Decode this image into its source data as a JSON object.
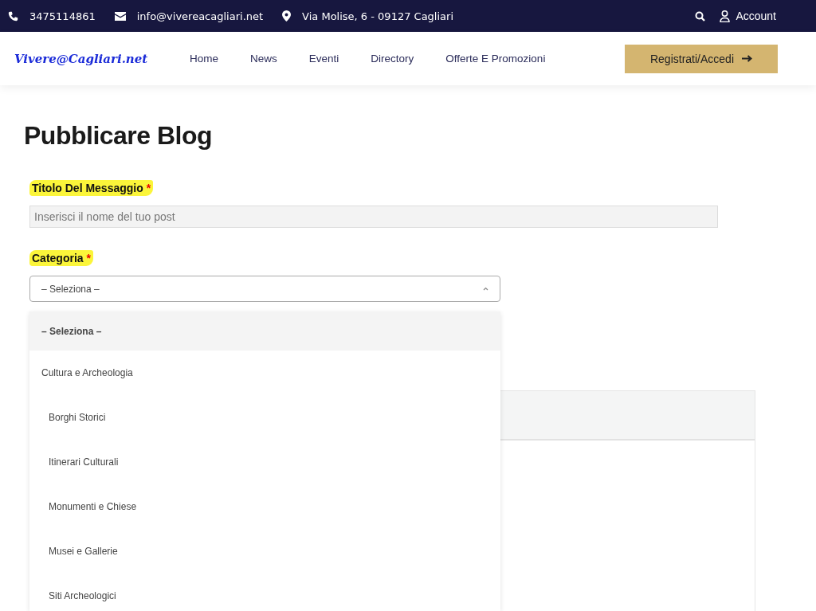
{
  "topbar": {
    "phone": "3475114861",
    "email": "info@vivereacagliari.net",
    "address": "Via Molise, 6 - 09127 Cagliari",
    "account": "Account"
  },
  "header": {
    "logo": "Vivere@Cagliari.net",
    "nav": [
      "Home",
      "News",
      "Eventi",
      "Directory",
      "Offerte E Promozioni"
    ],
    "cta": "Registrati/Accedi"
  },
  "page": {
    "title": "Pubblicare Blog",
    "fields": [
      {
        "label": "Titolo Del Messaggio",
        "required_mark": "*",
        "kind": "text",
        "placeholder": "Inserisci il nome del tuo post"
      },
      {
        "label": "Categoria",
        "required_mark": "*",
        "kind": "select",
        "value": "– Seleziona –",
        "expanded": true
      }
    ],
    "dropdown": [
      {
        "label": "– Seleziona –",
        "selected": true
      },
      {
        "label": "Cultura e Archeologia",
        "selected": false,
        "children": [
          {
            "label": "Borghi Storici",
            "selected": false
          },
          {
            "label": "Itinerari Culturali",
            "selected": false
          },
          {
            "label": "Monumenti e Chiese",
            "selected": false
          },
          {
            "label": "Musei e Gallerie",
            "selected": false
          },
          {
            "label": "Siti Archeologici",
            "selected": false
          }
        ]
      }
    ]
  }
}
